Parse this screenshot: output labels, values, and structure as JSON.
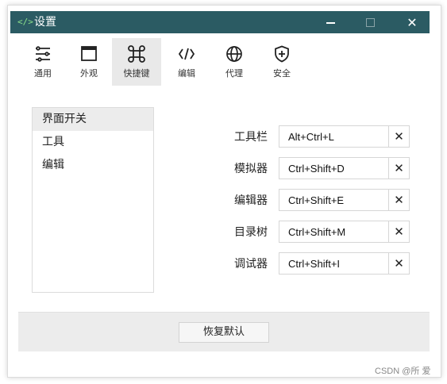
{
  "window": {
    "title": "设置",
    "app_icon": "</>",
    "minimize_icon": "minimize-icon",
    "maximize_icon": "maximize-icon",
    "close_icon": "close-icon",
    "close_glyph": "✕",
    "titlebar_color": "#2b5b63"
  },
  "toolbar": {
    "items": [
      {
        "label": "通用",
        "icon": "sliders-icon"
      },
      {
        "label": "外观",
        "icon": "window-icon"
      },
      {
        "label": "快捷键",
        "icon": "command-key-icon",
        "active": true
      },
      {
        "label": "编辑",
        "icon": "code-icon"
      },
      {
        "label": "代理",
        "icon": "globe-icon"
      },
      {
        "label": "安全",
        "icon": "shield-plus-icon"
      }
    ]
  },
  "sidebar": {
    "items": [
      {
        "label": "界面开关",
        "selected": true
      },
      {
        "label": "工具"
      },
      {
        "label": "编辑"
      }
    ]
  },
  "shortcuts": [
    {
      "label": "工具栏",
      "value": "Alt+Ctrl+L"
    },
    {
      "label": "模拟器",
      "value": "Ctrl+Shift+D"
    },
    {
      "label": "编辑器",
      "value": "Ctrl+Shift+E"
    },
    {
      "label": "目录树",
      "value": "Ctrl+Shift+M"
    },
    {
      "label": "调试器",
      "value": "Ctrl+Shift+I"
    }
  ],
  "clear_glyph": "✕",
  "footer": {
    "restore_label": "恢复默认"
  },
  "watermark": "CSDN @所 爱"
}
